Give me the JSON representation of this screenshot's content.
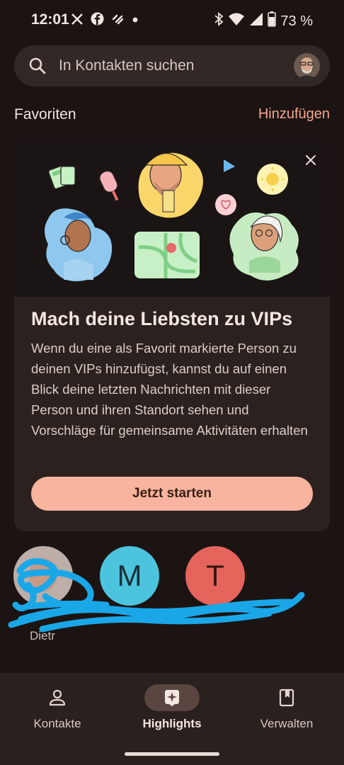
{
  "status_bar": {
    "time": "12:01",
    "battery": "73 %",
    "notification_icons": [
      "x-icon",
      "facebook-icon",
      "heart-link-icon",
      "dot-icon"
    ],
    "system_icons": [
      "bluetooth-icon",
      "wifi-icon",
      "signal-icon",
      "battery-icon"
    ]
  },
  "search": {
    "placeholder": "In Kontakten suchen"
  },
  "favorites_header": {
    "title": "Favoriten",
    "add_label": "Hinzufügen"
  },
  "promo_card": {
    "title": "Mach deine Liebsten zu VIPs",
    "body": "Wenn du eine als Favorit markierte Person zu deinen VIPs hinzufügst, kannst du auf einen Blick deine letzten Nachrichten mit dieser Person und ihren Standort sehen und Vorschläge für gemeinsame Aktivitäten erhalten",
    "cta": "Jetzt starten"
  },
  "favorites": [
    {
      "initial": "",
      "color": "#c2b2ac",
      "name": "Dietr"
    },
    {
      "initial": "M",
      "color": "#4cc4dd",
      "name": ""
    },
    {
      "initial": "T",
      "color": "#e5645b",
      "name": ""
    }
  ],
  "bottom_nav": {
    "items": [
      {
        "label": "Kontakte",
        "icon": "person-icon",
        "active": false
      },
      {
        "label": "Highlights",
        "icon": "highlights-icon",
        "active": true
      },
      {
        "label": "Verwalten",
        "icon": "bookmark-icon",
        "active": false
      }
    ]
  },
  "colors": {
    "background": "#1c1412",
    "accent": "#f6a790",
    "cta_bg": "#f8b49e",
    "scribble": "#1aa7e8"
  }
}
